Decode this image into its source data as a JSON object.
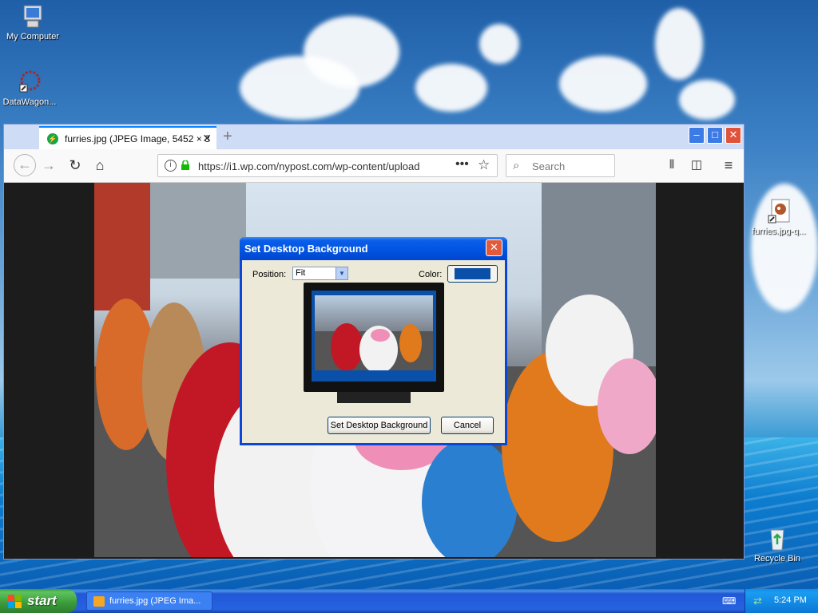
{
  "desktop": {
    "icons": [
      {
        "label": "My Computer"
      },
      {
        "label": "DataWagon..."
      },
      {
        "label": "furries.jpg-q..."
      },
      {
        "label": "Recycle Bin"
      }
    ]
  },
  "browser": {
    "tab_title": "furries.jpg (JPEG Image, 5452 × 3",
    "new_tab": "+",
    "url": "https://i1.wp.com/nypost.com/wp-content/upload",
    "search_placeholder": "Search",
    "window_buttons": {
      "minimize": "–",
      "maximize": "□",
      "close": "✕"
    }
  },
  "dialog": {
    "title": "Set Desktop Background",
    "position_label": "Position:",
    "position_value": "Fit",
    "color_label": "Color:",
    "color_value": "#0a4fa8",
    "ok_button": "Set Desktop Background",
    "cancel_button": "Cancel"
  },
  "taskbar": {
    "start_label": "start",
    "task_label": "furries.jpg (JPEG Ima...",
    "clock": "5:24 PM"
  }
}
